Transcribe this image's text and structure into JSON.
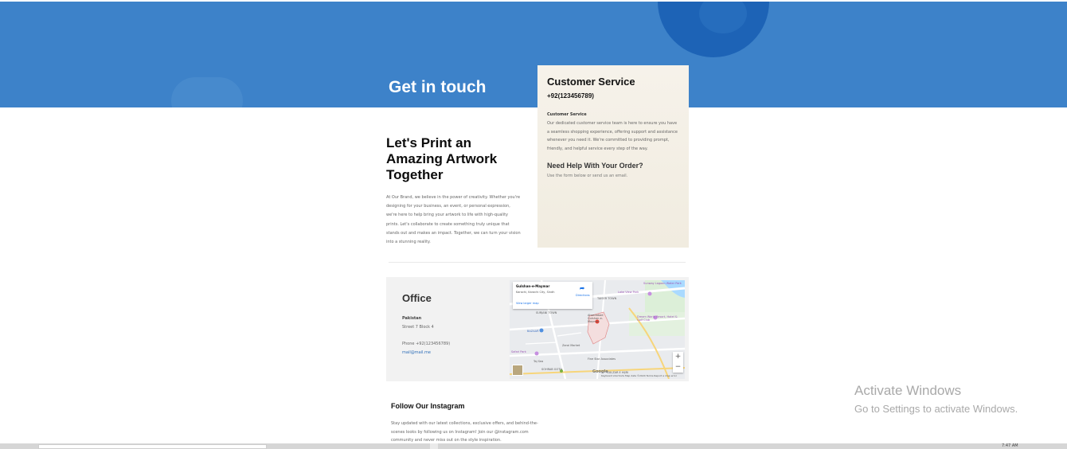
{
  "hero": {
    "title": "Get in touch",
    "background": "#3d82c9"
  },
  "customer_service": {
    "title": "Customer Service",
    "phone": "+92(123456789)",
    "subtitle": "Customer Service",
    "body": "Our dedicated customer service team is here to ensure you have a seamless shopping experience, offering support and assistance whenever you need it. We're committed to providing prompt, friendly, and helpful service every step of the way.",
    "help_title": "Need Help With Your Order?",
    "help_note": "Use the form below or send us an email."
  },
  "print_section": {
    "title": "Let's Print an Amazing Artwork Together",
    "body": "At Our Brand, we believe in the power of creativity. Whether you're designing for your business, an event, or personal expression, we're here to help bring your artwork to life with high-quality prints. Let's collaborate to create something truly unique that stands out and makes an impact. Together, we can turn your vision into a stunning reality."
  },
  "office": {
    "title": "Office",
    "country": "Pakistan",
    "street": "Street 7 Block 4",
    "phone": "Phone +92(123456789)",
    "email": "mail@mail.me"
  },
  "map": {
    "place_name": "Gulshan-e-Maymar",
    "address": "Karachi, Karachi City, Sindh",
    "view_larger": "View larger map",
    "directions": "Directions",
    "zoom_in": "+",
    "zoom_out": "−",
    "labels": {
      "taiser_town": "TAISER TOWN",
      "surjani_town": "SURJANI TOWN",
      "ahsanabad": "Ahsanabad Gulshan-e-Maymar",
      "bazaar": "BAZAAR",
      "lake_view": "Lake View Park",
      "dream_world": "Dream World Resort, Hotel & Golf Club",
      "safari": "Safari Park",
      "taj_sea": "Taj Sea",
      "zarai_market": "Zarai Market",
      "sohrab_goth": "SOHRAB GOTH",
      "fine_star": "Fine Star Associates",
      "gulzar_hijri": "GULZAR E HIJRI",
      "water_park": "Sunway Lagoon Water Park"
    },
    "footer": "Keyboard shortcuts   Map data ©2024   Terms   Report a map error",
    "google": "Google"
  },
  "instagram": {
    "title": "Follow Our Instagram",
    "body": "Stay updated with our latest collections, exclusive offers, and behind-the-scenes looks by following us on Instagram! Join our @instagram.com community and never miss out on the style inspiration."
  },
  "watermark": {
    "title": "Activate Windows",
    "subtitle": "Go to Settings to activate Windows."
  },
  "taskbar": {
    "clock": "7:47 AM"
  }
}
